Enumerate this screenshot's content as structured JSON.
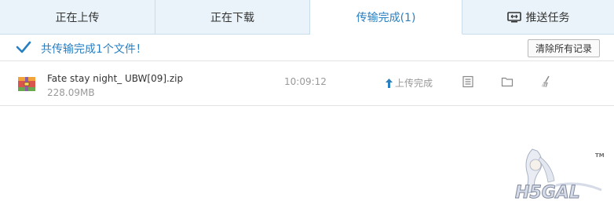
{
  "tabs": [
    {
      "label": "正在上传",
      "active": false
    },
    {
      "label": "正在下载",
      "active": false
    },
    {
      "label": "传输完成(1)",
      "active": true
    },
    {
      "label": "推送任务",
      "active": false,
      "icon": "tv-icon"
    }
  ],
  "summary": {
    "text": "共传输完成1个文件！",
    "icon": "check-icon",
    "clear_button": "清除所有记录"
  },
  "files": [
    {
      "name": "Fate stay night_ UBW[09].zip",
      "size": "228.09MB",
      "time": "10:09:12",
      "status": "上传完成",
      "icon": "zip-archive-icon",
      "actions": [
        "file-details-icon",
        "folder-icon",
        "broom-clear-icon"
      ]
    }
  ],
  "watermark": {
    "text": "H5GAL",
    "mark": "TM"
  },
  "colors": {
    "accent": "#2a7fc1",
    "tab_bg": "#eaf3f9",
    "border": "#c9dcea",
    "muted": "#999999"
  }
}
